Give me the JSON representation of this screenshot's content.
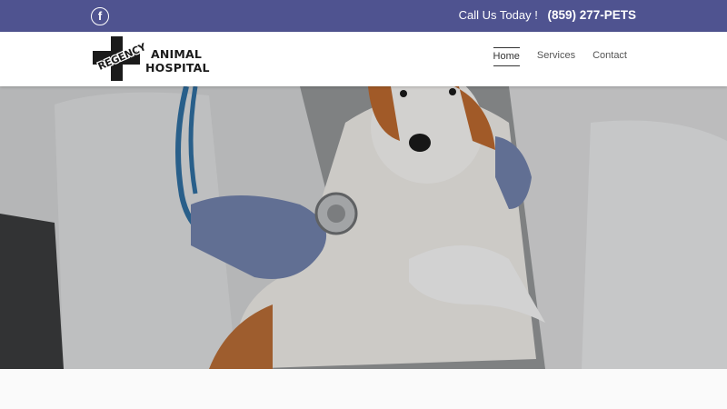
{
  "topbar": {
    "facebook_icon": "facebook-icon",
    "call_label": "Call Us Today !",
    "phone": "(859) 277-PETS",
    "bg_color": "#4f5390"
  },
  "logo": {
    "word_arc": "REGENCY",
    "line1": "ANIMAL",
    "line2": "HOSPITAL"
  },
  "nav": {
    "items": [
      "Home",
      "Services",
      "Contact"
    ],
    "active": "Home"
  },
  "hero": {
    "image_subject": "veterinarians examining a dog with a stethoscope"
  }
}
